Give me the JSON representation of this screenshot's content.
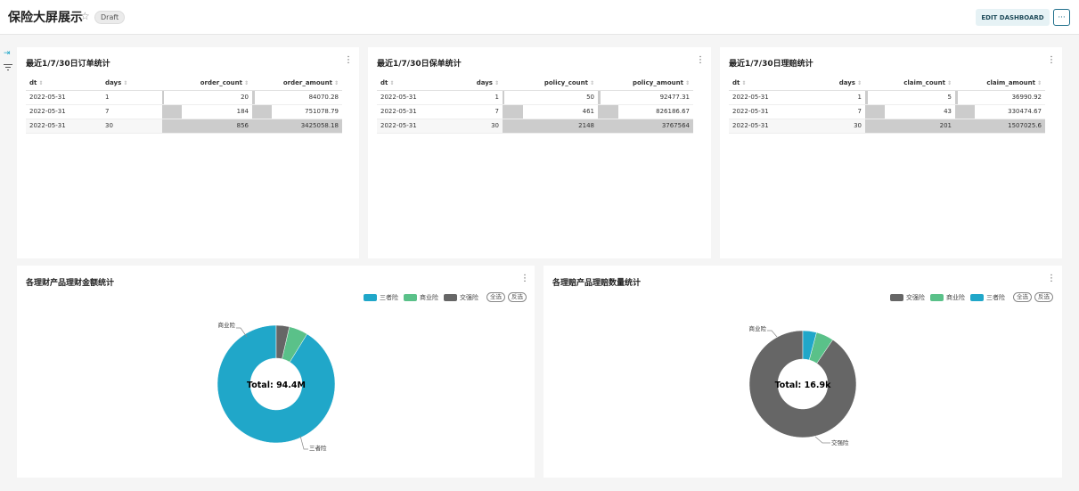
{
  "header": {
    "title": "保险大屏展示",
    "draft": "Draft",
    "edit_label": "EDIT DASHBOARD",
    "more_label": "···"
  },
  "tables": [
    {
      "title": "最近1/7/30日订单统计",
      "columns": [
        "dt",
        "days",
        "order_count",
        "order_amount"
      ],
      "rows": [
        [
          "2022-05-31",
          "1",
          "20",
          "84070.28"
        ],
        [
          "2022-05-31",
          "7",
          "184",
          "751078.79"
        ],
        [
          "2022-05-31",
          "30",
          "856",
          "3425058.18"
        ]
      ],
      "count_ratio": [
        0.023,
        0.215,
        1.0
      ],
      "amount_ratio": [
        0.025,
        0.219,
        1.0
      ]
    },
    {
      "title": "最近1/7/30日保单统计",
      "columns": [
        "dt",
        "days",
        "policy_count",
        "policy_amount"
      ],
      "rows": [
        [
          "2022-05-31",
          "1",
          "50",
          "92477.31"
        ],
        [
          "2022-05-31",
          "7",
          "461",
          "826186.67"
        ],
        [
          "2022-05-31",
          "30",
          "2148",
          "3767564"
        ]
      ],
      "count_ratio": [
        0.023,
        0.215,
        1.0
      ],
      "amount_ratio": [
        0.025,
        0.219,
        1.0
      ]
    },
    {
      "title": "最近1/7/30日理赔统计",
      "columns": [
        "dt",
        "days",
        "claim_count",
        "claim_amount"
      ],
      "rows": [
        [
          "2022-05-31",
          "1",
          "5",
          "36990.92"
        ],
        [
          "2022-05-31",
          "7",
          "43",
          "330474.67"
        ],
        [
          "2022-05-31",
          "30",
          "201",
          "1507025.6"
        ]
      ],
      "count_ratio": [
        0.025,
        0.214,
        1.0
      ],
      "amount_ratio": [
        0.025,
        0.219,
        1.0
      ]
    }
  ],
  "donuts": [
    {
      "title": "各理财产品理财金额统计",
      "legend": [
        {
          "label": "三者险",
          "color": "#20a7c9"
        },
        {
          "label": "商业险",
          "color": "#5ac189"
        },
        {
          "label": "交强险",
          "color": "#666666"
        }
      ],
      "btn_all": "全选",
      "btn_inverse": "反选",
      "center_label": "Total: 94.4M",
      "labels": {
        "top": "商业险",
        "bottom": "三者险"
      }
    },
    {
      "title": "各理赔产品理赔数量统计",
      "legend": [
        {
          "label": "交强险",
          "color": "#666666"
        },
        {
          "label": "商业险",
          "color": "#5ac189"
        },
        {
          "label": "三者险",
          "color": "#20a7c9"
        }
      ],
      "btn_all": "全选",
      "btn_inverse": "反选",
      "center_label": "Total: 16.9k",
      "labels": {
        "top": "商业险",
        "bottom": "交强险"
      }
    }
  ],
  "chart_data": [
    {
      "type": "pie",
      "title": "各理财产品理财金额统计",
      "categories": [
        "三者险",
        "商业险",
        "交强险"
      ],
      "values": [
        86.1,
        4.9,
        3.4
      ],
      "total_label": "Total: 94.4M"
    },
    {
      "type": "pie",
      "title": "各理赔产品理赔数量统计",
      "categories": [
        "交强险",
        "商业险",
        "三者险"
      ],
      "values": [
        15.3,
        0.9,
        0.7
      ],
      "total_label": "Total: 16.9k"
    }
  ]
}
